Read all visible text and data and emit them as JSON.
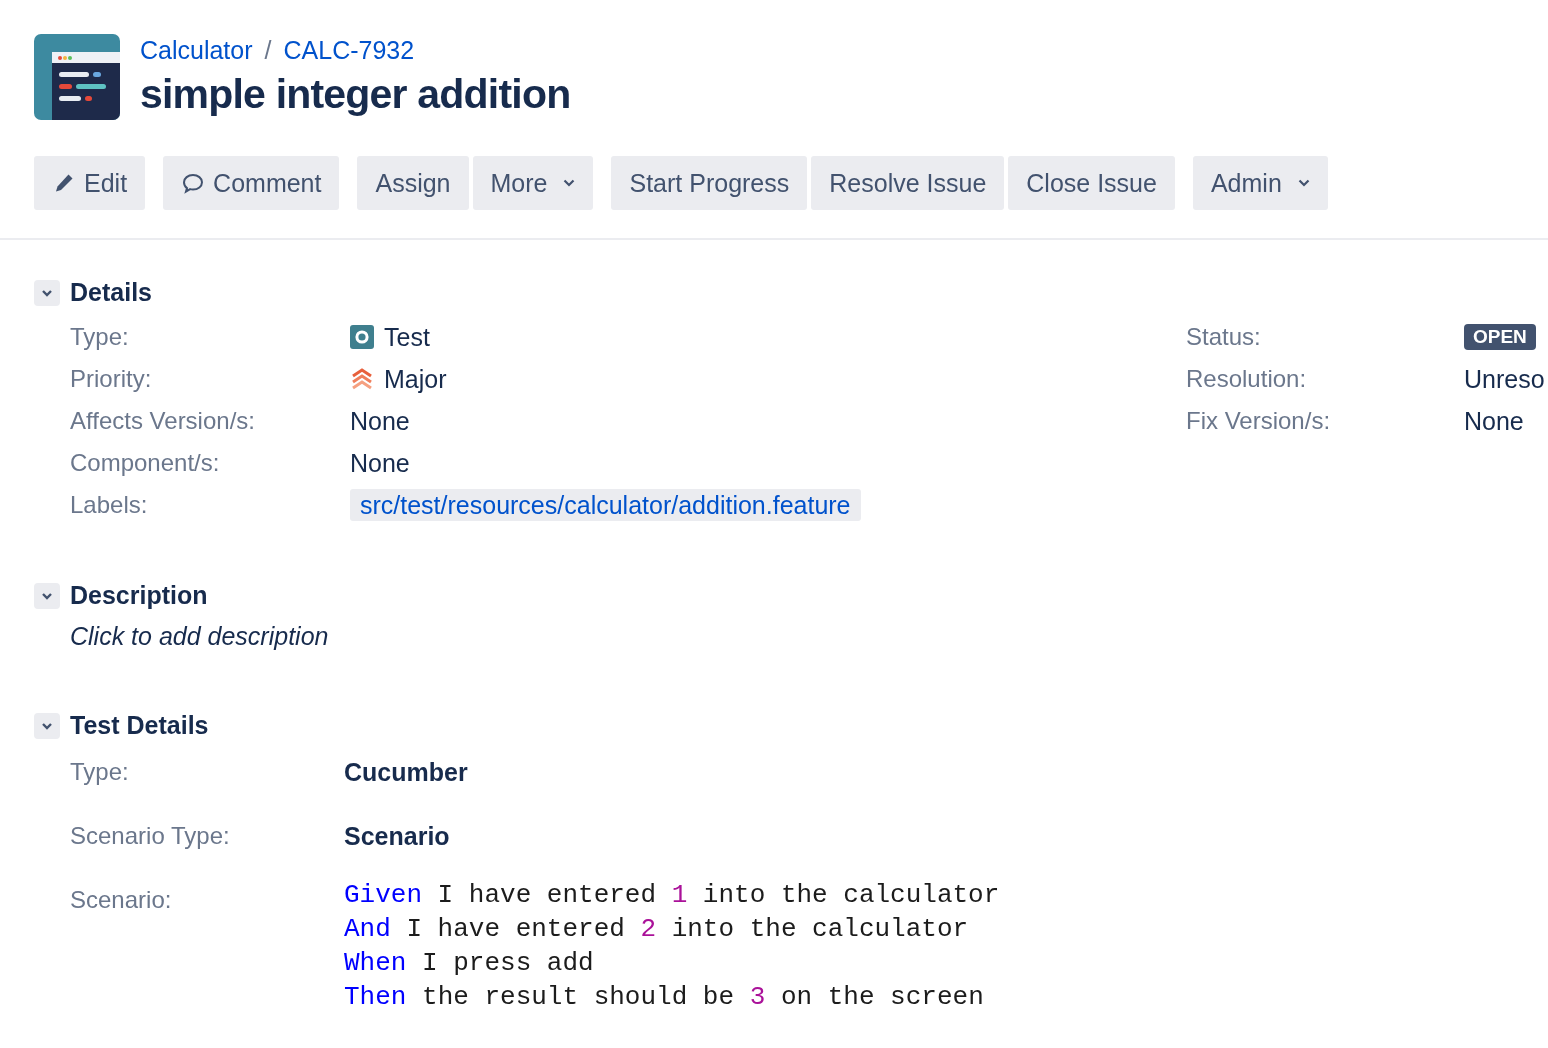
{
  "breadcrumbs": [
    {
      "label": "Calculator"
    },
    {
      "label": "CALC-7932"
    }
  ],
  "breadcrumb_separator": "/",
  "title": "simple integer addition",
  "toolbar": [
    {
      "buttons": [
        {
          "label": "Edit",
          "kind": "edit"
        }
      ]
    },
    {
      "buttons": [
        {
          "label": "Comment",
          "kind": "comment"
        }
      ]
    },
    {
      "buttons": [
        {
          "label": "Assign",
          "kind": "plain"
        },
        {
          "label": "More",
          "kind": "dropdown"
        }
      ]
    },
    {
      "buttons": [
        {
          "label": "Start Progress",
          "kind": "plain"
        },
        {
          "label": "Resolve Issue",
          "kind": "plain"
        },
        {
          "label": "Close Issue",
          "kind": "plain"
        }
      ]
    },
    {
      "buttons": [
        {
          "label": "Admin",
          "kind": "dropdown"
        }
      ]
    }
  ],
  "details": {
    "heading": "Details",
    "expanded": true,
    "left": [
      {
        "label": "Type:",
        "kind": "issue_type",
        "value": "Test"
      },
      {
        "label": "Priority:",
        "kind": "priority",
        "value": "Major"
      },
      {
        "label": "Affects Version/s:",
        "kind": "plain",
        "value": "None"
      },
      {
        "label": "Component/s:",
        "kind": "plain",
        "value": "None"
      },
      {
        "label": "Labels:",
        "kind": "label",
        "value": "src/test/resources/calculator/addition.feature"
      }
    ],
    "right": [
      {
        "label": "Status:",
        "kind": "status",
        "value": "OPEN"
      },
      {
        "label": "Resolution:",
        "kind": "plain",
        "value": "Unreso"
      },
      {
        "label": "Fix Version/s:",
        "kind": "plain",
        "value": "None"
      }
    ]
  },
  "description": {
    "heading": "Description",
    "expanded": true,
    "placeholder": "Click to add description"
  },
  "test_details": {
    "heading": "Test Details",
    "expanded": true,
    "fields": [
      {
        "label": "Type:",
        "value": "Cucumber"
      },
      {
        "label": "Scenario Type:",
        "value": "Scenario"
      }
    ],
    "scenario_label": "Scenario:",
    "scenario": [
      [
        {
          "kind": "keyword",
          "text": "Given"
        },
        {
          "kind": "text",
          "text": " I have entered "
        },
        {
          "kind": "number",
          "text": "1"
        },
        {
          "kind": "text",
          "text": " into the calculator"
        }
      ],
      [
        {
          "kind": "keyword",
          "text": "And"
        },
        {
          "kind": "text",
          "text": " I have entered "
        },
        {
          "kind": "number",
          "text": "2"
        },
        {
          "kind": "text",
          "text": " into the calculator"
        }
      ],
      [
        {
          "kind": "keyword",
          "text": "When"
        },
        {
          "kind": "text",
          "text": " I press add"
        }
      ],
      [
        {
          "kind": "keyword",
          "text": "Then"
        },
        {
          "kind": "text",
          "text": " the result should be "
        },
        {
          "kind": "number",
          "text": "3"
        },
        {
          "kind": "text",
          "text": " on the screen"
        }
      ]
    ]
  }
}
